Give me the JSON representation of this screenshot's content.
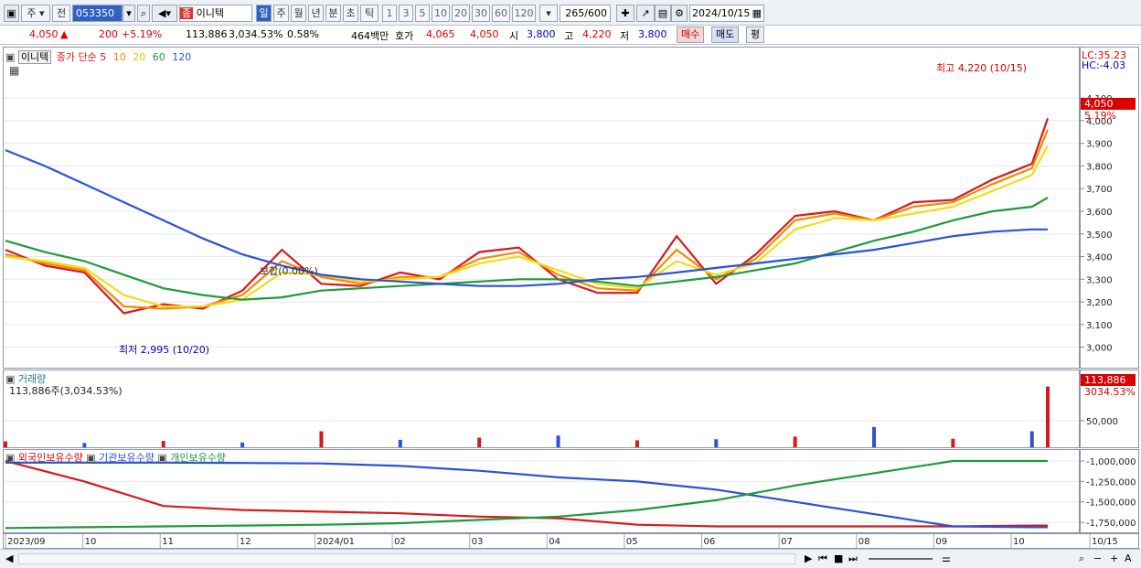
{
  "toolbar": {
    "market": "주",
    "prev": "전",
    "code": "053350",
    "name_badge": "종",
    "name": "이니텍",
    "periods": [
      "일",
      "주",
      "월",
      "년",
      "분",
      "초",
      "틱"
    ],
    "intervals": [
      "1",
      "3",
      "5",
      "10",
      "20",
      "30",
      "60",
      "120"
    ],
    "count": "265",
    "count_max": "/600",
    "date": "2024/10/15"
  },
  "quote": {
    "price": "4,050",
    "arrow": "▲",
    "change": "200",
    "change_pct": "+5.19%",
    "volume": "113,886",
    "volume_pct": "3,034.53%",
    "turnover_pct": "0.58%",
    "amount": "464백만",
    "bid_label": "호가",
    "ask": "4,065",
    "bid": "4,050",
    "open_label": "시",
    "open": "3,800",
    "high_label": "고",
    "high": "4,220",
    "low_label": "저",
    "low": "3,800",
    "buy_btn": "매수",
    "sell_btn": "매도",
    "eval_btn": "평"
  },
  "price_panel": {
    "legend_name": "이니텍",
    "legend_ma": "종가 단순",
    "ma_periods": [
      "5",
      "10",
      "20",
      "60",
      "120"
    ],
    "ma_colors": [
      "#d7191c",
      "#f08c00",
      "#f2dc1e",
      "#1f9a3a",
      "#2b52d6"
    ],
    "high_marker": "최고 4,220 (10/15)",
    "low_marker": "최저 2,995 (10/20)",
    "flat_marker": "보합(0.00%)",
    "lc": "LC:35.23",
    "hc": "HC:-4.03",
    "last_price": "4,050",
    "last_pct": "5.19%"
  },
  "volume_panel": {
    "title": "거래량",
    "subtitle": "113,886주(3,034.53%)",
    "last_volume": "113,886",
    "last_pct": "3034.53%"
  },
  "holding_panel": {
    "legend": [
      "외국인보유수량",
      "기관보유수량",
      "개인보유수량"
    ]
  },
  "chart_data": [
    {
      "type": "line",
      "title": "",
      "ylim": [
        2950,
        4250
      ],
      "yticks": [
        "3,000",
        "3,100",
        "3,200",
        "3,300",
        "3,400",
        "3,500",
        "3,600",
        "3,700",
        "3,800",
        "3,900",
        "4,000",
        "4,100"
      ],
      "x": [
        0,
        10,
        20,
        30,
        40,
        50,
        60,
        70,
        80,
        90,
        100,
        110,
        120,
        130,
        140,
        150,
        160,
        170,
        180,
        190,
        200,
        210,
        220,
        230,
        240,
        250,
        260,
        264
      ],
      "series": [
        {
          "name": "5",
          "values": [
            3430,
            3360,
            3330,
            3150,
            3190,
            3170,
            3250,
            3430,
            3280,
            3270,
            3330,
            3300,
            3420,
            3440,
            3300,
            3240,
            3240,
            3490,
            3280,
            3410,
            3580,
            3600,
            3560,
            3640,
            3650,
            3740,
            3810,
            4010
          ]
        },
        {
          "name": "10",
          "values": [
            3410,
            3370,
            3340,
            3180,
            3170,
            3180,
            3230,
            3380,
            3310,
            3280,
            3310,
            3310,
            3390,
            3420,
            3320,
            3260,
            3250,
            3430,
            3300,
            3390,
            3560,
            3590,
            3560,
            3620,
            3640,
            3720,
            3790,
            3960
          ]
        },
        {
          "name": "20",
          "values": [
            3400,
            3380,
            3350,
            3230,
            3180,
            3180,
            3210,
            3330,
            3320,
            3290,
            3300,
            3310,
            3370,
            3400,
            3340,
            3280,
            3260,
            3380,
            3320,
            3370,
            3520,
            3570,
            3560,
            3590,
            3620,
            3690,
            3760,
            3890
          ]
        },
        {
          "name": "60",
          "values": [
            3470,
            3420,
            3380,
            3320,
            3260,
            3230,
            3210,
            3220,
            3250,
            3260,
            3270,
            3280,
            3290,
            3300,
            3300,
            3290,
            3270,
            3290,
            3310,
            3340,
            3370,
            3420,
            3470,
            3510,
            3560,
            3600,
            3620,
            3660
          ]
        },
        {
          "name": "120",
          "values": [
            3870,
            3800,
            3720,
            3640,
            3560,
            3480,
            3410,
            3360,
            3320,
            3300,
            3290,
            3280,
            3270,
            3270,
            3280,
            3300,
            3310,
            3330,
            3350,
            3370,
            3390,
            3410,
            3430,
            3460,
            3490,
            3510,
            3520,
            3520
          ]
        }
      ]
    },
    {
      "type": "bar",
      "title": "",
      "ylim": [
        0,
        120000
      ],
      "yticks": [
        "50,000"
      ],
      "x": [
        0,
        20,
        40,
        60,
        80,
        100,
        120,
        140,
        160,
        180,
        200,
        220,
        240,
        260,
        264
      ],
      "values": [
        11000,
        8000,
        12000,
        9000,
        30000,
        14000,
        18000,
        22000,
        13000,
        15000,
        20000,
        38000,
        16000,
        30000,
        113886
      ]
    },
    {
      "type": "line",
      "title": "",
      "ylim": [
        -1850000,
        -1000000
      ],
      "yticks": [
        "-1,000,000",
        "-1,250,000",
        "-1,500,000",
        "-1,750,000"
      ],
      "xticks": [
        "2023/09",
        "10",
        "11",
        "12",
        "2024/01",
        "02",
        "03",
        "04",
        "05",
        "06",
        "07",
        "08",
        "09",
        "10",
        "10/15"
      ],
      "x": [
        0,
        20,
        40,
        60,
        80,
        100,
        120,
        140,
        160,
        180,
        200,
        220,
        240,
        260,
        264
      ],
      "series": [
        {
          "name": "외국인보유수량",
          "values": [
            -1000000,
            -1250000,
            -1550000,
            -1600000,
            -1620000,
            -1640000,
            -1680000,
            -1700000,
            -1780000,
            -1800000,
            -1800000,
            -1800000,
            -1800000,
            -1790000,
            -1790000
          ]
        },
        {
          "name": "기관보유수량",
          "values": [
            -1020000,
            -1020000,
            -1020000,
            -1025000,
            -1030000,
            -1060000,
            -1120000,
            -1200000,
            -1250000,
            -1350000,
            -1500000,
            -1650000,
            -1800000,
            -1810000,
            -1810000
          ]
        },
        {
          "name": "개인보유수량",
          "values": [
            -1820000,
            -1810000,
            -1800000,
            -1790000,
            -1780000,
            -1760000,
            -1720000,
            -1680000,
            -1600000,
            -1480000,
            -1300000,
            -1150000,
            -1000000,
            -1000000,
            -1000000
          ]
        }
      ]
    }
  ]
}
